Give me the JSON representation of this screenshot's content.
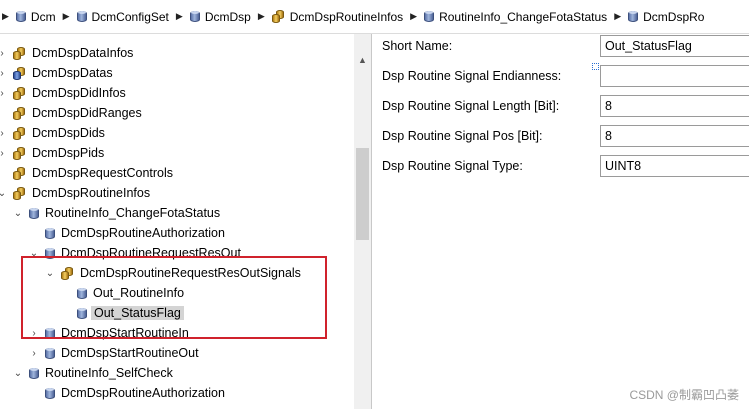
{
  "breadcrumb": [
    {
      "label": "Dcm",
      "icon": "cylinder-icon"
    },
    {
      "label": "DcmConfigSet",
      "icon": "cylinder-icon"
    },
    {
      "label": "DcmDsp",
      "icon": "cylinder-icon"
    },
    {
      "label": "DcmDspRoutineInfos",
      "icon": "folder-icon"
    },
    {
      "label": "RoutineInfo_ChangeFotaStatus",
      "icon": "cylinder-icon"
    },
    {
      "label": "DcmDspRo",
      "icon": "cylinder-icon"
    }
  ],
  "tree": {
    "items": [
      {
        "label": "DcmDspDataInfos",
        "icon": "folder-icon",
        "toggle": "›",
        "level": 0
      },
      {
        "label": "DcmDspDatas",
        "icon": "folder-lock-icon",
        "toggle": "›",
        "level": 0
      },
      {
        "label": "DcmDspDidInfos",
        "icon": "folder-icon",
        "toggle": "›",
        "level": 0
      },
      {
        "label": "DcmDspDidRanges",
        "icon": "folder-icon",
        "toggle": "",
        "level": 0
      },
      {
        "label": "DcmDspDids",
        "icon": "folder-icon",
        "toggle": "›",
        "level": 0
      },
      {
        "label": "DcmDspPids",
        "icon": "folder-icon",
        "toggle": "›",
        "level": 0
      },
      {
        "label": "DcmDspRequestControls",
        "icon": "folder-icon",
        "toggle": "",
        "level": 0
      },
      {
        "label": "DcmDspRoutineInfos",
        "icon": "folder-icon",
        "toggle": "⌄",
        "level": 0
      },
      {
        "label": "RoutineInfo_ChangeFotaStatus",
        "icon": "cylinder-icon",
        "toggle": "⌄",
        "level": 1
      },
      {
        "label": "DcmDspRoutineAuthorization",
        "icon": "cylinder-icon",
        "toggle": "",
        "level": 2
      },
      {
        "label": "DcmDspRoutineRequestResOut",
        "icon": "cylinder-icon",
        "toggle": "⌄",
        "level": 2
      },
      {
        "label": "DcmDspRoutineRequestResOutSignals",
        "icon": "folder-icon",
        "toggle": "⌄",
        "level": 3
      },
      {
        "label": "Out_RoutineInfo",
        "icon": "cylinder-icon",
        "toggle": "",
        "level": 4
      },
      {
        "label": "Out_StatusFlag",
        "icon": "cylinder-icon",
        "toggle": "",
        "level": 4,
        "selected": true
      },
      {
        "label": "DcmDspStartRoutineIn",
        "icon": "cylinder-icon",
        "toggle": "›",
        "level": 2
      },
      {
        "label": "DcmDspStartRoutineOut",
        "icon": "cylinder-icon",
        "toggle": "›",
        "level": 2
      },
      {
        "label": "RoutineInfo_SelfCheck",
        "icon": "cylinder-icon",
        "toggle": "⌄",
        "level": 1
      },
      {
        "label": "DcmDspRoutineAuthorization",
        "icon": "cylinder-icon",
        "toggle": "",
        "level": 2
      }
    ]
  },
  "properties": [
    {
      "label": "Short Name:",
      "value": ""
    },
    {
      "label": "Dsp Routine Signal Endianness:",
      "value": ""
    },
    {
      "label": "Dsp Routine Signal Length [Bit]:",
      "value": "8"
    },
    {
      "label": "Dsp Routine Signal Pos [Bit]:",
      "value": "8"
    },
    {
      "label": "Dsp Routine Signal Type:",
      "value": "UINT8"
    }
  ],
  "short_name_value": "Out_StatusFlag",
  "watermark": "CSDN @制霸凹凸萎",
  "colors": {
    "highlight_border": "#d0222c",
    "selected_bg": "#d4d4d4"
  }
}
